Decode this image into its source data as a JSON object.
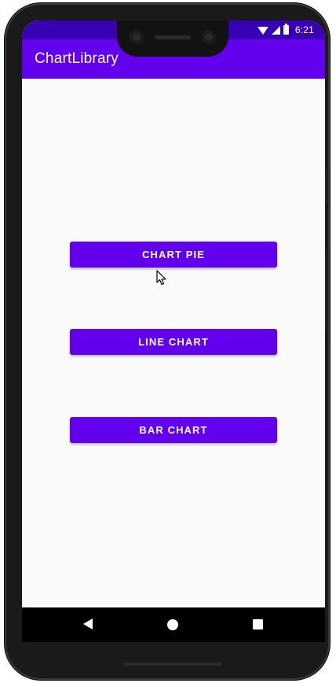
{
  "status_bar": {
    "time": "6:21",
    "icons": [
      "wifi-icon",
      "signal-icon",
      "battery-charging-icon"
    ]
  },
  "app_bar": {
    "title": "ChartLibrary"
  },
  "main": {
    "buttons": [
      {
        "label": "CHART PIE"
      },
      {
        "label": "LINE CHART"
      },
      {
        "label": "BAR CHART"
      }
    ]
  },
  "nav_bar": {
    "icons": [
      "back-icon",
      "home-icon",
      "recents-icon"
    ]
  },
  "colors": {
    "status_bar": "#3700b3",
    "app_bar": "#6200ee",
    "button": "#6200ee",
    "background": "#fafafa"
  }
}
